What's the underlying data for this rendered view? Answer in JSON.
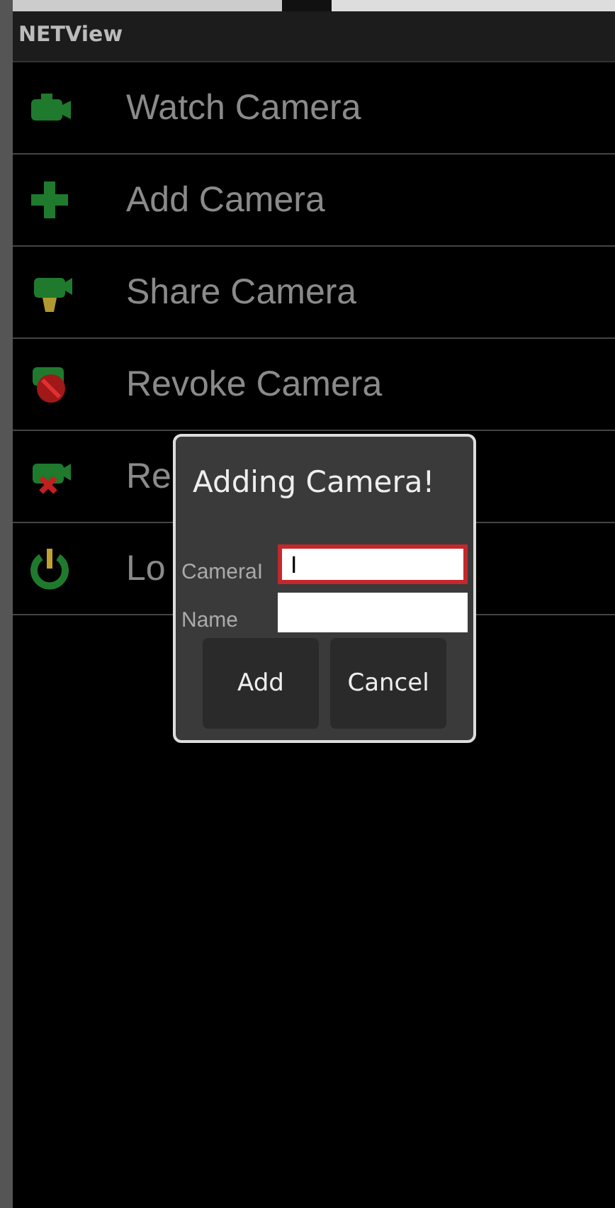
{
  "app_bar": {
    "title": "NETView"
  },
  "menu": [
    {
      "label": "Watch Camera",
      "kind": "camera"
    },
    {
      "label": "Add Camera",
      "kind": "plus"
    },
    {
      "label": "Share Camera",
      "kind": "share"
    },
    {
      "label": "Revoke Camera",
      "kind": "revoke"
    },
    {
      "label": "Re",
      "kind": "remove"
    },
    {
      "label": "Lo",
      "kind": "power"
    }
  ],
  "dialog": {
    "title": "Adding Camera!",
    "fields": [
      {
        "label": "CameraI",
        "value": "I",
        "focused": true
      },
      {
        "label": "Name",
        "focused": false
      }
    ],
    "buttons": [
      "Add",
      "Cancel"
    ]
  }
}
